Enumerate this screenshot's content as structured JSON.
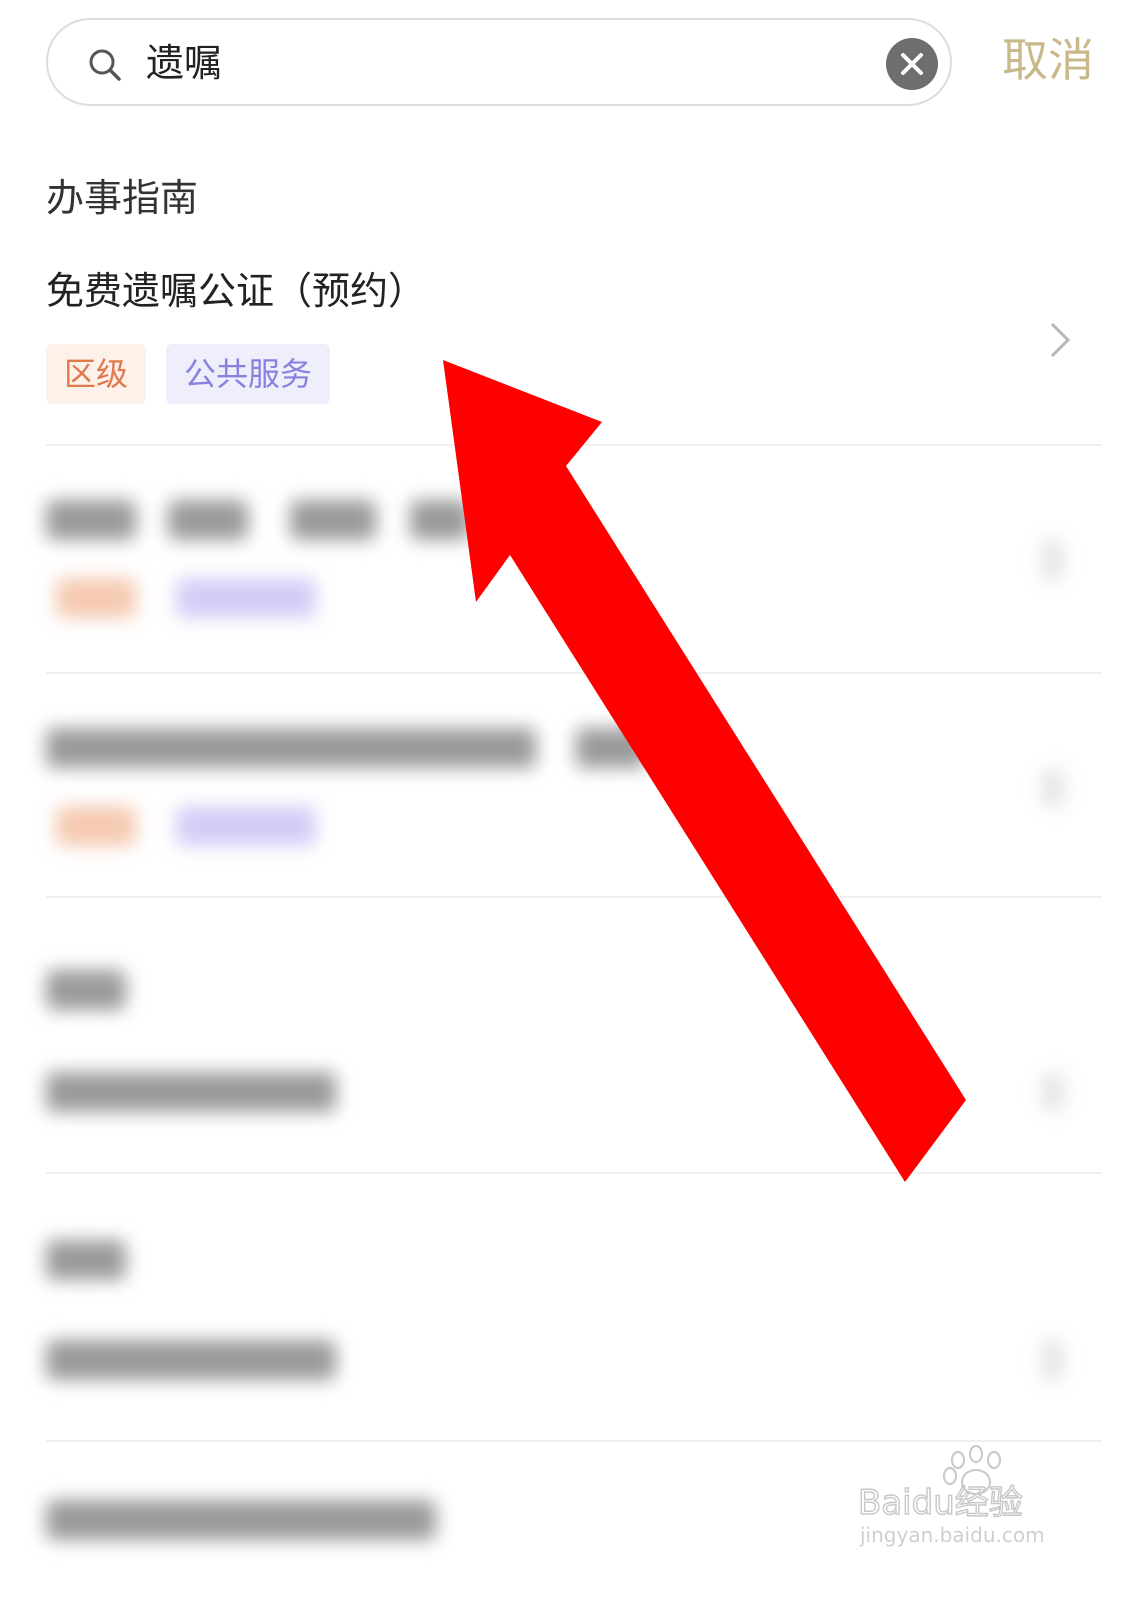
{
  "search": {
    "value": "遗嘱",
    "cancel_label": "取消"
  },
  "section": {
    "title": "办事指南"
  },
  "result": {
    "title": "免费遗嘱公证（预约）",
    "tags": [
      "区级",
      "公共服务"
    ]
  },
  "colors": {
    "cancel": "#c9b98a",
    "tag_district_text": "#e07a4d",
    "tag_district_bg": "#fdf1ea",
    "tag_public_text": "#8a80e0",
    "tag_public_bg": "#efeefb",
    "arrow": "#ff0000"
  },
  "icons": {
    "search": "search-icon",
    "clear": "clear-icon",
    "chevron": "chevron-right-icon",
    "annotation": "red-arrow-icon"
  },
  "watermark": {
    "brand": "Baidu经验",
    "url": "jingyan.baidu.com"
  }
}
